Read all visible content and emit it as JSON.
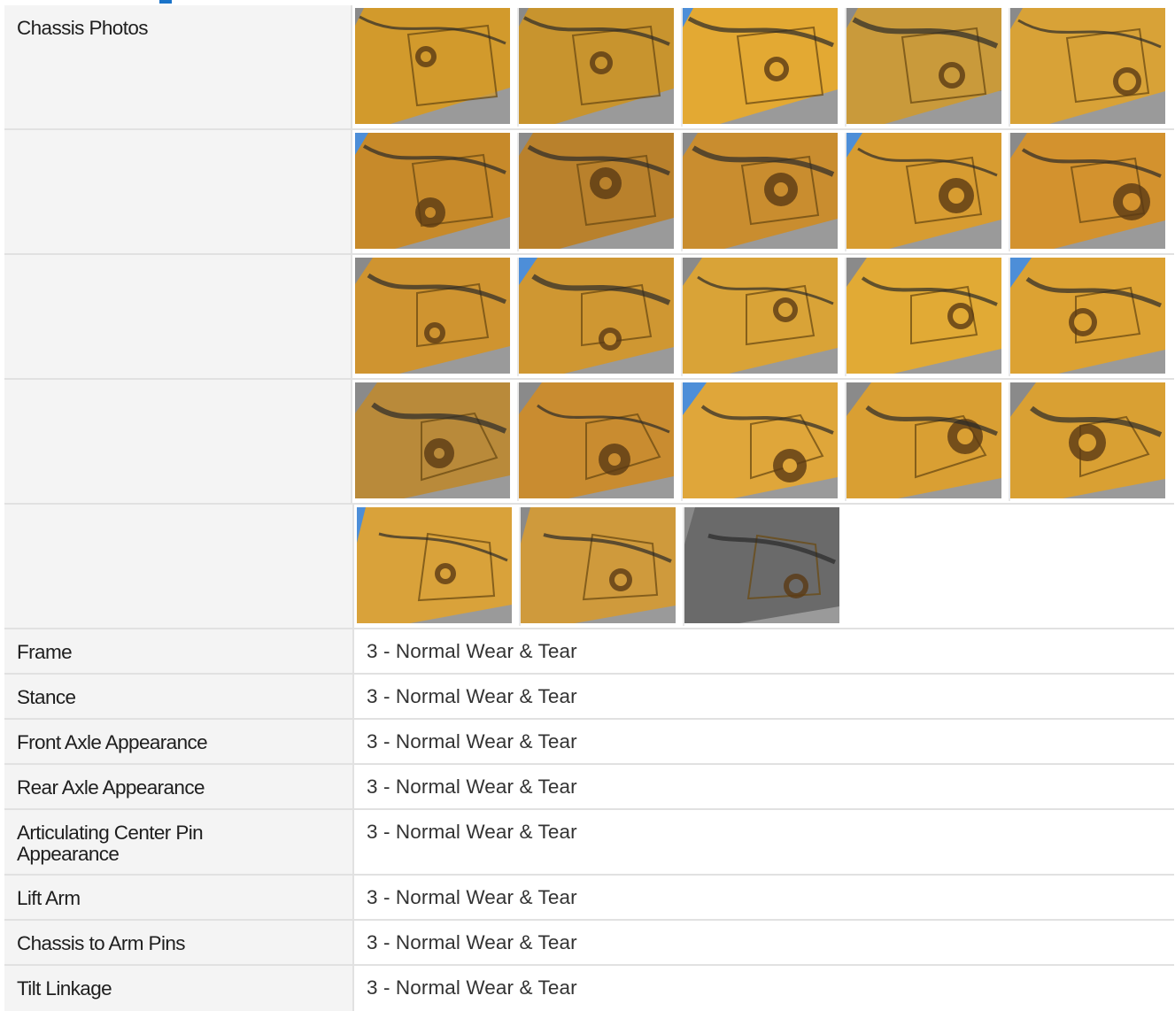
{
  "section": {
    "label": "Chassis Photos",
    "photo_rows": [
      [
        {
          "icon": "frame-photo",
          "tint": "#d29a2c"
        },
        {
          "icon": "frame-photo",
          "tint": "#c8942e"
        },
        {
          "icon": "frame-photo",
          "tint": "#e3a933"
        },
        {
          "icon": "frame-photo",
          "tint": "#c99a3b"
        },
        {
          "icon": "frame-photo",
          "tint": "#d8a237"
        }
      ],
      [
        {
          "icon": "frame-photo",
          "tint": "#c78a2a"
        },
        {
          "icon": "frame-photo",
          "tint": "#b9812c"
        },
        {
          "icon": "frame-photo",
          "tint": "#c98d2f"
        },
        {
          "icon": "frame-photo",
          "tint": "#d79c31"
        },
        {
          "icon": "frame-photo",
          "tint": "#d3922e"
        }
      ],
      [
        {
          "icon": "frame-photo",
          "tint": "#cf9430"
        },
        {
          "icon": "frame-photo",
          "tint": "#cf9732"
        },
        {
          "icon": "frame-photo",
          "tint": "#d9a337"
        },
        {
          "icon": "frame-photo",
          "tint": "#e1aa35"
        },
        {
          "icon": "frame-photo",
          "tint": "#dca233"
        }
      ],
      [
        {
          "icon": "frame-photo",
          "tint": "#b98a3a"
        },
        {
          "icon": "frame-photo",
          "tint": "#c98c30"
        },
        {
          "icon": "frame-photo",
          "tint": "#dfa63a"
        },
        {
          "icon": "frame-photo",
          "tint": "#d99f33"
        },
        {
          "icon": "frame-photo",
          "tint": "#d9a033"
        }
      ],
      [
        {
          "icon": "frame-photo",
          "tint": "#d9a23a"
        },
        {
          "icon": "frame-photo",
          "tint": "#cf9a3c"
        },
        {
          "icon": "frame-photo",
          "tint": "#6a6a6a"
        }
      ]
    ]
  },
  "rows": [
    {
      "label": "Frame",
      "value": "3 - Normal Wear & Tear"
    },
    {
      "label": "Stance",
      "value": "3 - Normal Wear & Tear"
    },
    {
      "label": "Front Axle Appearance",
      "value": "3 - Normal Wear & Tear"
    },
    {
      "label": "Rear Axle Appearance",
      "value": "3 - Normal Wear & Tear"
    },
    {
      "label": "Articulating Center Pin Appearance",
      "value": "3 - Normal Wear & Tear"
    },
    {
      "label": "Lift Arm",
      "value": "3 - Normal Wear & Tear"
    },
    {
      "label": "Chassis to Arm Pins",
      "value": "3 - Normal Wear & Tear"
    },
    {
      "label": "Tilt Linkage",
      "value": "3 - Normal Wear & Tear"
    }
  ],
  "colors": {
    "accent": "#1a73c9",
    "label_bg": "#f4f4f4",
    "border": "#e1e1e1"
  }
}
